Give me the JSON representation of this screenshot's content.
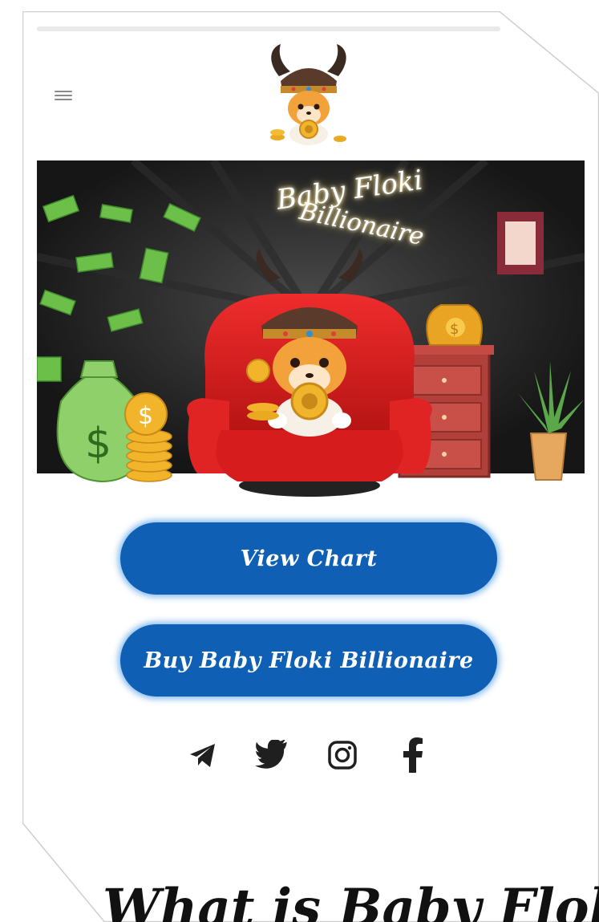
{
  "header": {
    "menu_icon": "hamburger-menu-icon",
    "logo_icon": "baby-floki-viking-dog-logo"
  },
  "hero": {
    "title_line1": "Baby Floki",
    "title_line2": "Billionaire"
  },
  "buttons": {
    "view_chart": "View Chart",
    "buy": "Buy Baby Floki Billionaire"
  },
  "socials": [
    {
      "name": "telegram",
      "icon": "telegram-icon"
    },
    {
      "name": "twitter",
      "icon": "twitter-icon"
    },
    {
      "name": "instagram",
      "icon": "instagram-icon"
    },
    {
      "name": "facebook",
      "icon": "facebook-icon"
    }
  ],
  "section": {
    "heading_partial": "What is Baby Floki"
  },
  "colors": {
    "button_blue": "#0f5fb4",
    "button_glow": "#6eafeb",
    "hero_bg": "#1b1b1b",
    "chair_red": "#d81f1f"
  }
}
